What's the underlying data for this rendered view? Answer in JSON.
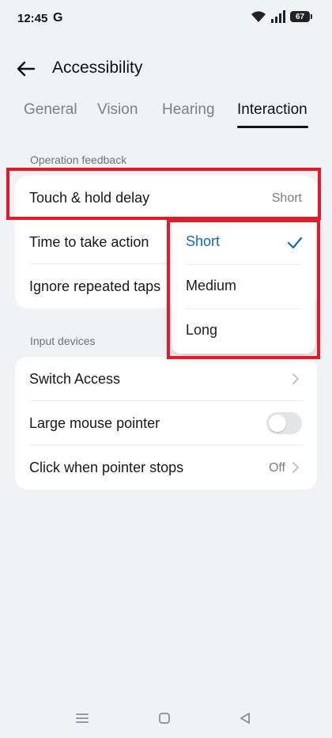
{
  "status_bar": {
    "time": "12:45",
    "carrier_icon": "G",
    "battery": "67"
  },
  "header": {
    "title": "Accessibility"
  },
  "tabs": [
    {
      "label": "General",
      "active": false
    },
    {
      "label": "Vision",
      "active": false
    },
    {
      "label": "Hearing",
      "active": false
    },
    {
      "label": "Interaction",
      "active": true
    }
  ],
  "operation_feedback": {
    "section_label": "Operation feedback",
    "rows": [
      {
        "label": "Touch & hold delay",
        "value": "Short"
      },
      {
        "label": "Time to take action"
      },
      {
        "label": "Ignore repeated taps"
      }
    ]
  },
  "input_devices": {
    "section_label": "Input devices",
    "rows": [
      {
        "label": "Switch Access"
      },
      {
        "label": "Large mouse pointer",
        "toggle_on": false
      },
      {
        "label": "Click when pointer stops",
        "value": "Off"
      }
    ]
  },
  "delay_popup": {
    "options": [
      {
        "label": "Short",
        "selected": true
      },
      {
        "label": "Medium",
        "selected": false
      },
      {
        "label": "Long",
        "selected": false
      }
    ]
  },
  "colors": {
    "accent": "#1767b4",
    "highlight": "#e01b2a",
    "background": "#f1f2f6"
  }
}
